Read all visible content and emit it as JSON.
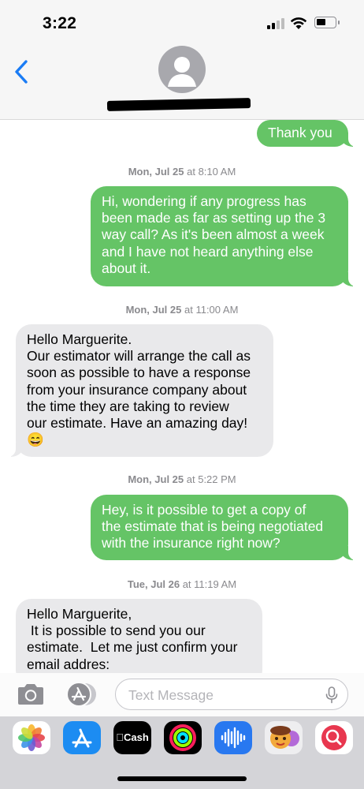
{
  "status_bar": {
    "time": "3:22"
  },
  "conversation": {
    "messages": [
      {
        "dir": "out",
        "text": "Thank you"
      },
      {
        "dir": "out",
        "text": "Hi, wondering if any progress has\nbeen made as far as setting up the 3\nway call? As it's been almost a week\nand I have not heard anything else\nabout it."
      },
      {
        "dir": "in",
        "text": "Hello Marguerite.\nOur estimator will arrange the call as\nsoon as possible to have a response\nfrom your insurance company about\nthe time they are taking to review\nour estimate. Have an amazing day!\n😄"
      },
      {
        "dir": "out",
        "text": "Hey, is it possible to get a copy of\nthe estimate that is being negotiated\nwith the insurance right now?"
      },
      {
        "dir": "in",
        "text": "Hello Marguerite,\n It is possible to send you our\nestimate.  Let me just confirm your\nemail addres:"
      }
    ],
    "timestamps": [
      {
        "day": "Mon, Jul 25",
        "time": "8:10 AM"
      },
      {
        "day": "Mon, Jul 25",
        "time": "11:00 AM"
      },
      {
        "day": "Mon, Jul 25",
        "time": "5:22 PM"
      },
      {
        "day": "Tue, Jul 26",
        "time": "11:19 AM"
      }
    ]
  },
  "compose": {
    "placeholder": "Text Message"
  },
  "app_drawer": {
    "cash_label": "Cash",
    "apps": [
      "photos-icon",
      "app-store-icon",
      "apple-cash-icon",
      "fitness-icon",
      "audio-message-icon",
      "memoji-icon",
      "web-search-icon"
    ]
  },
  "colors": {
    "sent_bubble": "#65c466",
    "received_bubble": "#e9e9eb",
    "accent": "#1a7cf5"
  }
}
